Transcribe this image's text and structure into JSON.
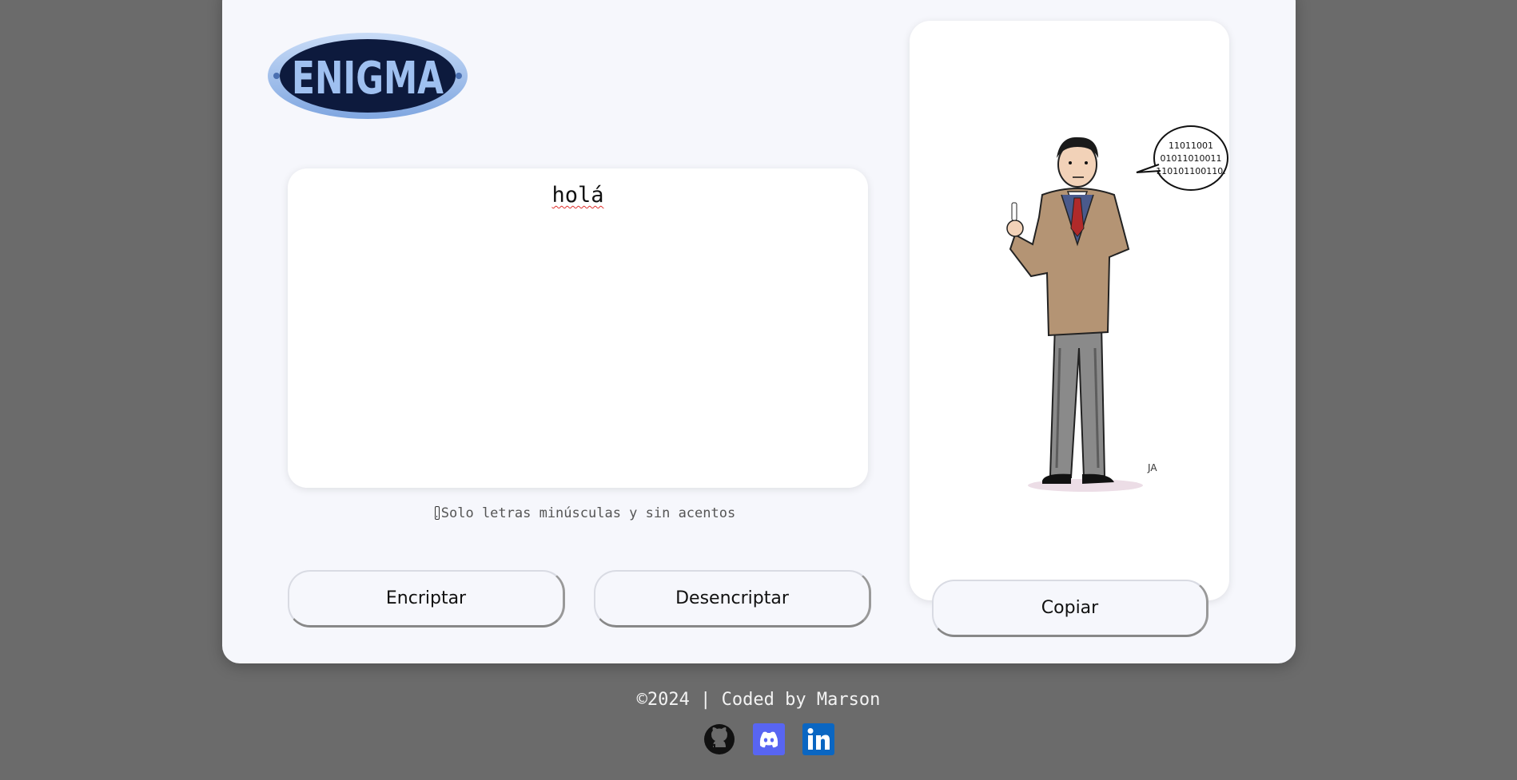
{
  "logo": {
    "text": "ENIGMA"
  },
  "editor": {
    "value": "holá"
  },
  "hint": {
    "text": "Solo letras minúsculas y sin acentos"
  },
  "buttons": {
    "encrypt": "Encriptar",
    "decrypt": "Desencriptar",
    "copy": "Copiar"
  },
  "illustration": {
    "speech_bubble_lines": [
      "11011001",
      "01011010011",
      "110101100110."
    ],
    "signature": "JA"
  },
  "footer": {
    "copyright": "©2024 | Coded by Marson",
    "social": [
      {
        "name": "GitHub",
        "icon": "github-icon"
      },
      {
        "name": "Discord",
        "icon": "discord-icon"
      },
      {
        "name": "LinkedIn",
        "icon": "linkedin-icon"
      }
    ]
  },
  "colors": {
    "page_bg": "#6b6b6b",
    "card_bg": "#f6f7fc",
    "logo_blue": "#8fb4ea",
    "discord": "#5865f2",
    "linkedin": "#0a66c2"
  }
}
